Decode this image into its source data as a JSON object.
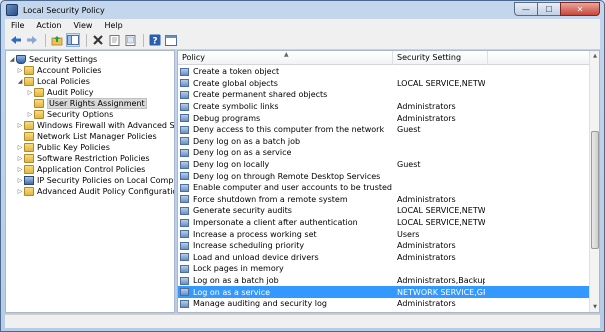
{
  "window": {
    "title": "Local Security Policy",
    "min_glyph": "—",
    "max_glyph": "☐",
    "close_glyph": "✕"
  },
  "menu": {
    "items": [
      "File",
      "Action",
      "View",
      "Help"
    ]
  },
  "toolbar": {
    "icons": [
      "back-icon",
      "forward-icon",
      "up-folder-icon",
      "show-hide-tree-icon",
      "delete-icon",
      "properties-icon",
      "export-list-icon",
      "help-icon",
      "console-icon"
    ]
  },
  "tree": {
    "items": [
      {
        "label": "Security Settings",
        "level": 0,
        "expanded": true,
        "icon": "shield"
      },
      {
        "label": "Account Policies",
        "level": 1,
        "expanded": false,
        "icon": "folder"
      },
      {
        "label": "Local Policies",
        "level": 1,
        "expanded": true,
        "icon": "folder"
      },
      {
        "label": "Audit Policy",
        "level": 2,
        "expanded": false,
        "icon": "folder"
      },
      {
        "label": "User Rights Assignment",
        "level": 2,
        "expanded": false,
        "icon": "folder",
        "selected": true
      },
      {
        "label": "Security Options",
        "level": 2,
        "expanded": false,
        "icon": "folder"
      },
      {
        "label": "Windows Firewall with Advanced Security",
        "level": 1,
        "expanded": false,
        "icon": "folder"
      },
      {
        "label": "Network List Manager Policies",
        "level": 1,
        "expanded": null,
        "icon": "folder"
      },
      {
        "label": "Public Key Policies",
        "level": 1,
        "expanded": false,
        "icon": "folder"
      },
      {
        "label": "Software Restriction Policies",
        "level": 1,
        "expanded": false,
        "icon": "folder"
      },
      {
        "label": "Application Control Policies",
        "level": 1,
        "expanded": false,
        "icon": "folder"
      },
      {
        "label": "IP Security Policies on Local Computer",
        "level": 1,
        "expanded": false,
        "icon": "computer"
      },
      {
        "label": "Advanced Audit Policy Configuration",
        "level": 1,
        "expanded": false,
        "icon": "folder"
      }
    ]
  },
  "table": {
    "headers": [
      "Policy",
      "Security Setting"
    ],
    "rows": [
      {
        "policy": "Create a token object",
        "setting": ""
      },
      {
        "policy": "Create global objects",
        "setting": "LOCAL SERVICE,NETWO..."
      },
      {
        "policy": "Create permanent shared objects",
        "setting": ""
      },
      {
        "policy": "Create symbolic links",
        "setting": "Administrators"
      },
      {
        "policy": "Debug programs",
        "setting": "Administrators"
      },
      {
        "policy": "Deny access to this computer from the network",
        "setting": "Guest"
      },
      {
        "policy": "Deny log on as a batch job",
        "setting": ""
      },
      {
        "policy": "Deny log on as a service",
        "setting": ""
      },
      {
        "policy": "Deny log on locally",
        "setting": "Guest"
      },
      {
        "policy": "Deny log on through Remote Desktop Services",
        "setting": ""
      },
      {
        "policy": "Enable computer and user accounts to be trusted for delega...",
        "setting": ""
      },
      {
        "policy": "Force shutdown from a remote system",
        "setting": "Administrators"
      },
      {
        "policy": "Generate security audits",
        "setting": "LOCAL SERVICE,NETWO..."
      },
      {
        "policy": "Impersonate a client after authentication",
        "setting": "LOCAL SERVICE,NETWO..."
      },
      {
        "policy": "Increase a process working set",
        "setting": "Users"
      },
      {
        "policy": "Increase scheduling priority",
        "setting": "Administrators"
      },
      {
        "policy": "Load and unload device drivers",
        "setting": "Administrators"
      },
      {
        "policy": "Lock pages in memory",
        "setting": ""
      },
      {
        "policy": "Log on as a batch job",
        "setting": "Administrators,Backup ..."
      },
      {
        "policy": "Log on as a service",
        "setting": "NETWORK SERVICE,GRO...",
        "selected": true
      },
      {
        "policy": "Manage auditing and security log",
        "setting": "Administrators"
      }
    ]
  }
}
